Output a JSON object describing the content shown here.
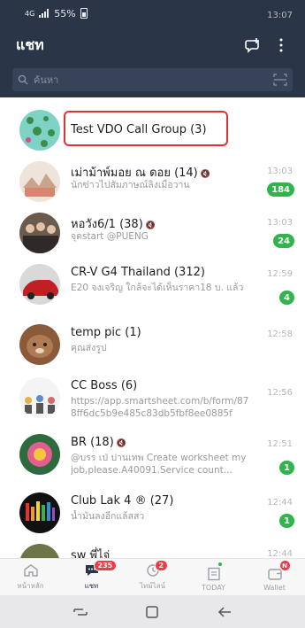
{
  "status": {
    "time": "13:07",
    "network": "4G",
    "battery": "55%"
  },
  "header": {
    "title": "แชท",
    "add_chat_icon": "add-chat-icon",
    "more_icon": "more-vertical-icon"
  },
  "search": {
    "placeholder": "ค้นหา",
    "value": ""
  },
  "chats": [
    {
      "name": "Test VDO Call Group (3)",
      "message": "",
      "time": "",
      "badge": "",
      "muted": false,
      "highlighted": true
    },
    {
      "name": "เม่าม้าพ์มอย ณ ดอย (14)",
      "message": "นักข่าวไปสัมภาษณ์ลิงเมื่อวาน",
      "time": "13:03",
      "badge": "184",
      "muted": true
    },
    {
      "name": "หอวัง6/1 (38)",
      "message": "จุดstart @PUENG",
      "time": "13:03",
      "badge": "24",
      "muted": true
    },
    {
      "name": "CR-V G4 Thailand (312)",
      "message": "E20 จงเจริญ ใกล้จะได้เห็นราคา18 บ. แล้ว",
      "time": "12:59",
      "badge": "4",
      "muted": false
    },
    {
      "name": "temp pic (1)",
      "message": "คุณส่งรูป",
      "time": "12:58",
      "badge": "",
      "muted": false
    },
    {
      "name": "CC Boss (6)",
      "message": "https://app.smartsheet.com/b/form/878ff6dc5b9e485c83db5fbf8ee0885f",
      "time": "12:56",
      "badge": "",
      "muted": false
    },
    {
      "name": "BR (18)",
      "message": "@บรร เป่ ปานเทพ Create worksheet my job,please.A40091.Service count...",
      "time": "12:51",
      "badge": "1",
      "muted": true
    },
    {
      "name": "Club Lak 4 ® (27)",
      "message": "น้ำมันลงอีกแล้สสว",
      "time": "12:44",
      "badge": "1",
      "muted": false
    },
    {
      "name": "sw พี่ไจ่",
      "message": "",
      "time": "12:44",
      "badge": "",
      "muted": false
    }
  ],
  "tabs": [
    {
      "label": "หน้าหลัก",
      "badge": ""
    },
    {
      "label": "แชท",
      "badge": "235"
    },
    {
      "label": "ไทม์ไลน์",
      "badge": "2"
    },
    {
      "label": "TODAY",
      "badge": ""
    },
    {
      "label": "Wallet",
      "badge": "N"
    }
  ],
  "colors": {
    "header_bg": "#2a3548",
    "badge_green": "#2fb54c",
    "badge_red": "#ef3b45",
    "highlight_border": "#e0303a"
  }
}
